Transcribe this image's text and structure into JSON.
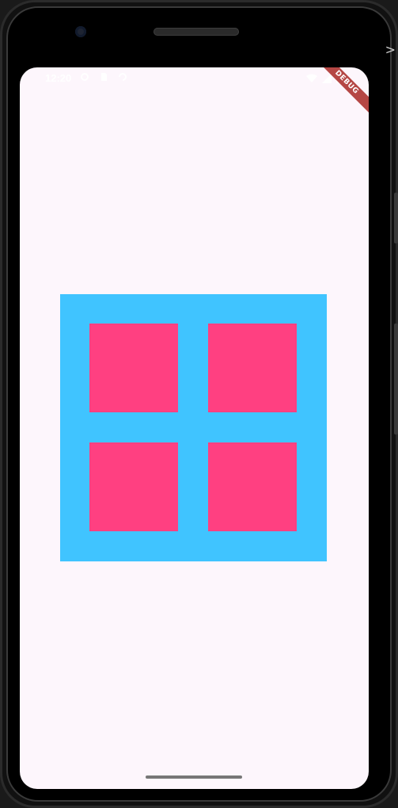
{
  "device": {
    "frame_color": "#111111"
  },
  "status_bar": {
    "time": "12:20",
    "left_icons": [
      "settings-icon",
      "sim-icon",
      "sync-icon"
    ],
    "right_icons": [
      "wifi-icon",
      "signal-icon",
      "battery-icon"
    ],
    "icon_color": "#ffffff"
  },
  "debug_banner": {
    "label": "DEBUG",
    "color": "#b54745"
  },
  "content": {
    "background": "#fdf6fc",
    "grid_container_color": "#40c4ff",
    "tile_color": "#ff4081",
    "tiles": [
      {
        "id": "tile-top-left"
      },
      {
        "id": "tile-top-right"
      },
      {
        "id": "tile-bottom-left"
      },
      {
        "id": "tile-bottom-right"
      }
    ]
  },
  "nav": {
    "home_indicator": "home-indicator"
  },
  "window_chrome": {
    "corner_glyph": ">"
  }
}
